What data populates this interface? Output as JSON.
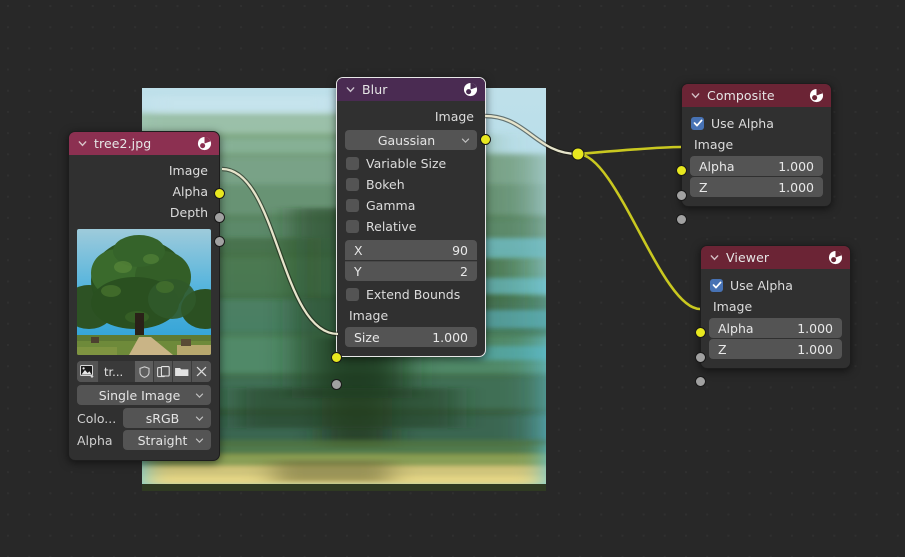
{
  "app": {
    "editor": "blender-compositor",
    "background_color": "#282828"
  },
  "backdrop": {
    "description": "horizontally blurred tree photo preview",
    "sky_color": "#b7dde8",
    "foliage_color": "#4d6b34",
    "path_color": "#e8d07e"
  },
  "nodes": {
    "image": {
      "title": "tree2.jpg",
      "header_color": "#8c3051",
      "outputs": [
        {
          "label": "Image",
          "socket": "image"
        },
        {
          "label": "Alpha",
          "socket": "value"
        },
        {
          "label": "Depth",
          "socket": "value"
        }
      ],
      "toolbar": {
        "browse_icon": "image-browse-icon",
        "name_value": "tr...",
        "shield_icon": "shield-icon",
        "copy_icon": "copy-icon",
        "folder_icon": "folder-icon",
        "close_icon": "close-icon"
      },
      "source_dropdown": "Single Image",
      "color_space_label": "Colo...",
      "color_space_value": "sRGB",
      "alpha_label": "Alpha",
      "alpha_value": "Straight"
    },
    "blur": {
      "title": "Blur",
      "header_color": "#4a2b52",
      "selected": true,
      "outputs": [
        {
          "label": "Image",
          "socket": "image"
        }
      ],
      "filter_type": "Gaussian",
      "checkboxes": [
        {
          "label": "Variable Size",
          "checked": false
        },
        {
          "label": "Bokeh",
          "checked": false
        },
        {
          "label": "Gamma",
          "checked": false
        },
        {
          "label": "Relative",
          "checked": false
        }
      ],
      "size_x": {
        "name": "X",
        "value": "90"
      },
      "size_y": {
        "name": "Y",
        "value": "2"
      },
      "extend_bounds": {
        "label": "Extend Bounds",
        "checked": false
      },
      "inputs": [
        {
          "label": "Image",
          "socket": "image"
        }
      ],
      "size_field": {
        "name": "Size",
        "value": "1.000"
      }
    },
    "composite": {
      "title": "Composite",
      "header_color": "#6b2435",
      "use_alpha": {
        "label": "Use Alpha",
        "checked": true
      },
      "inputs": [
        {
          "label": "Image",
          "socket": "image"
        },
        {
          "label": "Alpha",
          "value": "1.000",
          "socket": "value"
        },
        {
          "label": "Z",
          "value": "1.000",
          "socket": "value"
        }
      ]
    },
    "viewer": {
      "title": "Viewer",
      "header_color": "#6b2435",
      "use_alpha": {
        "label": "Use Alpha",
        "checked": true
      },
      "inputs": [
        {
          "label": "Image",
          "socket": "image"
        },
        {
          "label": "Alpha",
          "value": "1.000",
          "socket": "value"
        },
        {
          "label": "Z",
          "value": "1.000",
          "socket": "value"
        }
      ]
    }
  },
  "links": {
    "noodle_active_color": "#e8e6cd",
    "noodle_color": "#c8c825",
    "reroute_color": "#e8e81f"
  }
}
